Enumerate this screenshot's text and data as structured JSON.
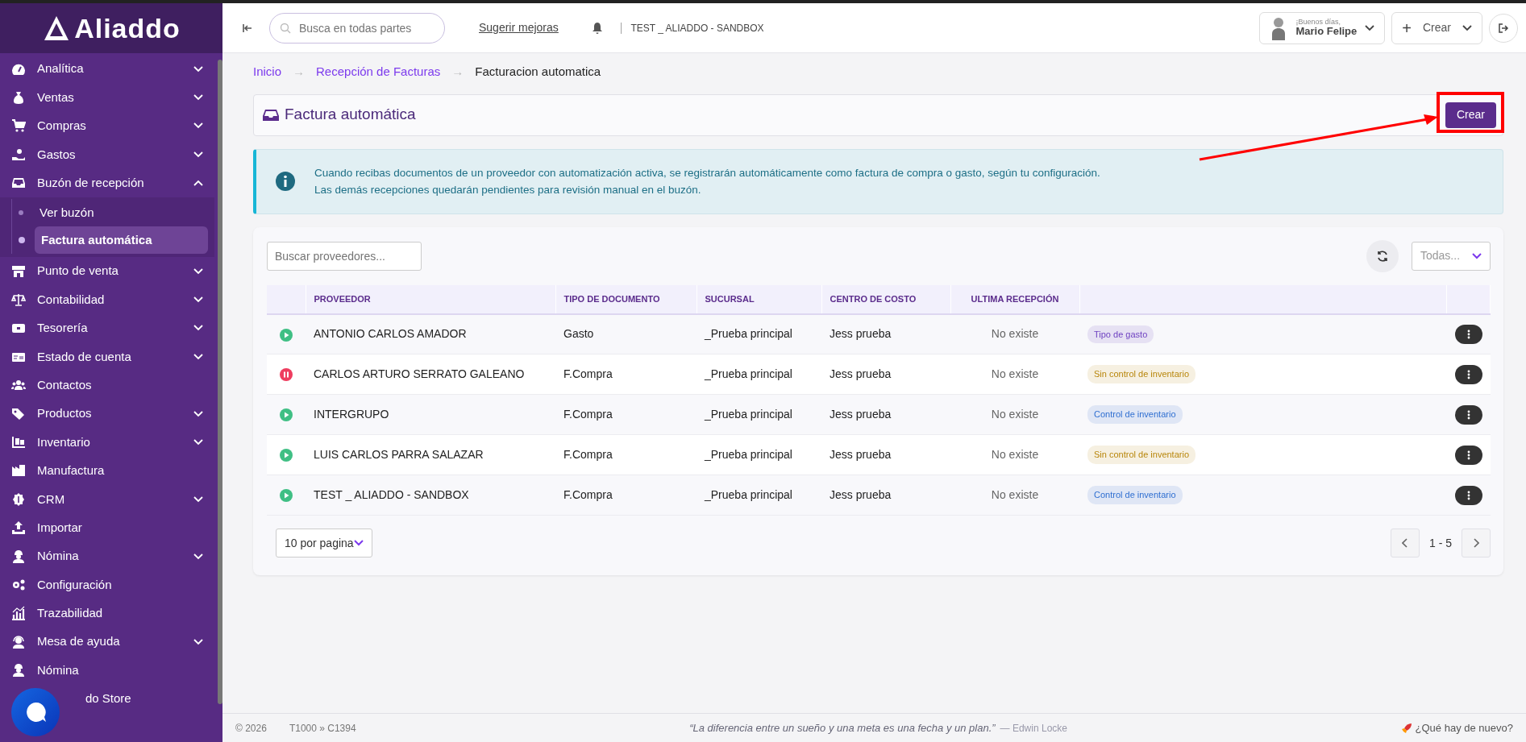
{
  "sidebar": {
    "logo": "Aliaddo",
    "items": [
      {
        "label": "Analítica",
        "kind": "group",
        "expanded": false
      },
      {
        "label": "Ventas",
        "kind": "group",
        "expanded": false
      },
      {
        "label": "Compras",
        "kind": "group",
        "expanded": false
      },
      {
        "label": "Gastos",
        "kind": "group",
        "expanded": false
      },
      {
        "label": "Buzón de recepción",
        "kind": "group",
        "expanded": true,
        "children": [
          {
            "label": "Ver buzón",
            "selected": false
          },
          {
            "label": "Factura automática",
            "selected": true
          }
        ]
      },
      {
        "label": "Punto de venta",
        "kind": "group",
        "expanded": false
      },
      {
        "label": "Contabilidad",
        "kind": "group",
        "expanded": false
      },
      {
        "label": "Tesorería",
        "kind": "group",
        "expanded": false
      },
      {
        "label": "Estado de cuenta",
        "kind": "group",
        "expanded": false
      },
      {
        "label": "Contactos",
        "kind": "link"
      },
      {
        "label": "Productos",
        "kind": "group",
        "expanded": false
      },
      {
        "label": "Inventario",
        "kind": "group",
        "expanded": false
      },
      {
        "label": "Manufactura",
        "kind": "link"
      },
      {
        "label": "CRM",
        "kind": "group",
        "expanded": false
      },
      {
        "label": "Importar",
        "kind": "link"
      },
      {
        "label": "Nómina",
        "kind": "group",
        "expanded": false
      },
      {
        "label": "Configuración",
        "kind": "link"
      },
      {
        "label": "Trazabilidad",
        "kind": "link"
      },
      {
        "label": "Mesa de ayuda",
        "kind": "group",
        "expanded": false
      },
      {
        "label": "Nómina",
        "kind": "link"
      },
      {
        "label": "do Store",
        "kind": "link"
      }
    ]
  },
  "topbar": {
    "search_placeholder": "Busca en todas partes",
    "suggest": "Sugerir mejoras",
    "divider": "|",
    "company": "TEST _ ALIADDO - SANDBOX",
    "greeting": "¡Buenos días,",
    "user": "Mario Felipe",
    "create_plus": "+",
    "create": "Crear"
  },
  "breadcrumb": [
    {
      "label": "Inicio",
      "kind": "link"
    },
    {
      "label": "→",
      "kind": "separator"
    },
    {
      "label": "Recepción de Facturas",
      "kind": "link"
    },
    {
      "label": "→",
      "kind": "separator"
    },
    {
      "label": "Facturacion automatica",
      "kind": "current"
    }
  ],
  "header": {
    "title": "Factura automática",
    "button": "Crear"
  },
  "alert": {
    "lines": [
      "Cuando recibas documentos de un proveedor con automatización activa, se registrarán automáticamente como factura de compra o gasto, según tu configuración.",
      "Las demás recepciones quedarán pendientes para revisión manual en el buzón."
    ]
  },
  "filters": {
    "search_placeholder": "Buscar proveedores...",
    "select": "Todas..."
  },
  "table": {
    "columns": [
      "PROVEEDOR",
      "TIPO DE DOCUMENTO",
      "SUCURSAL",
      "CENTRO DE COSTO",
      "ULTIMA RECEPCIÓN"
    ],
    "rows": [
      {
        "active": true,
        "provider": "ANTONIO CARLOS AMADOR",
        "doc_type": "Gasto",
        "branch": "_Prueba principal",
        "cost_center": "Jess prueba",
        "last": "No existe",
        "tag": "Tipo de gasto",
        "color": "#6f42c1"
      },
      {
        "active": false,
        "provider": "CARLOS ARTURO SERRATO GALEANO",
        "doc_type": "F.Compra",
        "branch": "_Prueba principal",
        "cost_center": "Jess prueba",
        "last": "No existe",
        "tag": "Sin control de inventario",
        "color": "#b8860b"
      },
      {
        "active": true,
        "provider": "INTERGRUPO",
        "doc_type": "F.Compra",
        "branch": "_Prueba principal",
        "cost_center": "Jess prueba",
        "last": "No existe",
        "tag": "Control de inventario",
        "color": "#2f6fd1"
      },
      {
        "active": true,
        "provider": "LUIS CARLOS PARRA SALAZAR",
        "doc_type": "F.Compra",
        "branch": "_Prueba principal",
        "cost_center": "Jess prueba",
        "last": "No existe",
        "tag": "Sin control de inventario",
        "color": "#b8860b"
      },
      {
        "active": true,
        "provider": "TEST _ ALIADDO - SANDBOX",
        "doc_type": "F.Compra",
        "branch": "_Prueba principal",
        "cost_center": "Jess prueba",
        "last": "No existe",
        "tag": "Control de inventario",
        "color": "#2f6fd1"
      }
    ]
  },
  "pagination": {
    "per_page": "10 por pagina",
    "range": "1 - 5"
  },
  "footer": {
    "copyright": "© 2026",
    "version": "T1000 » C1394",
    "quote": "“La diferencia entre un sueño y una meta es una fecha y un plan.”",
    "author": "— Edwin Locke",
    "news": "¿Qué hay de nuevo?"
  }
}
